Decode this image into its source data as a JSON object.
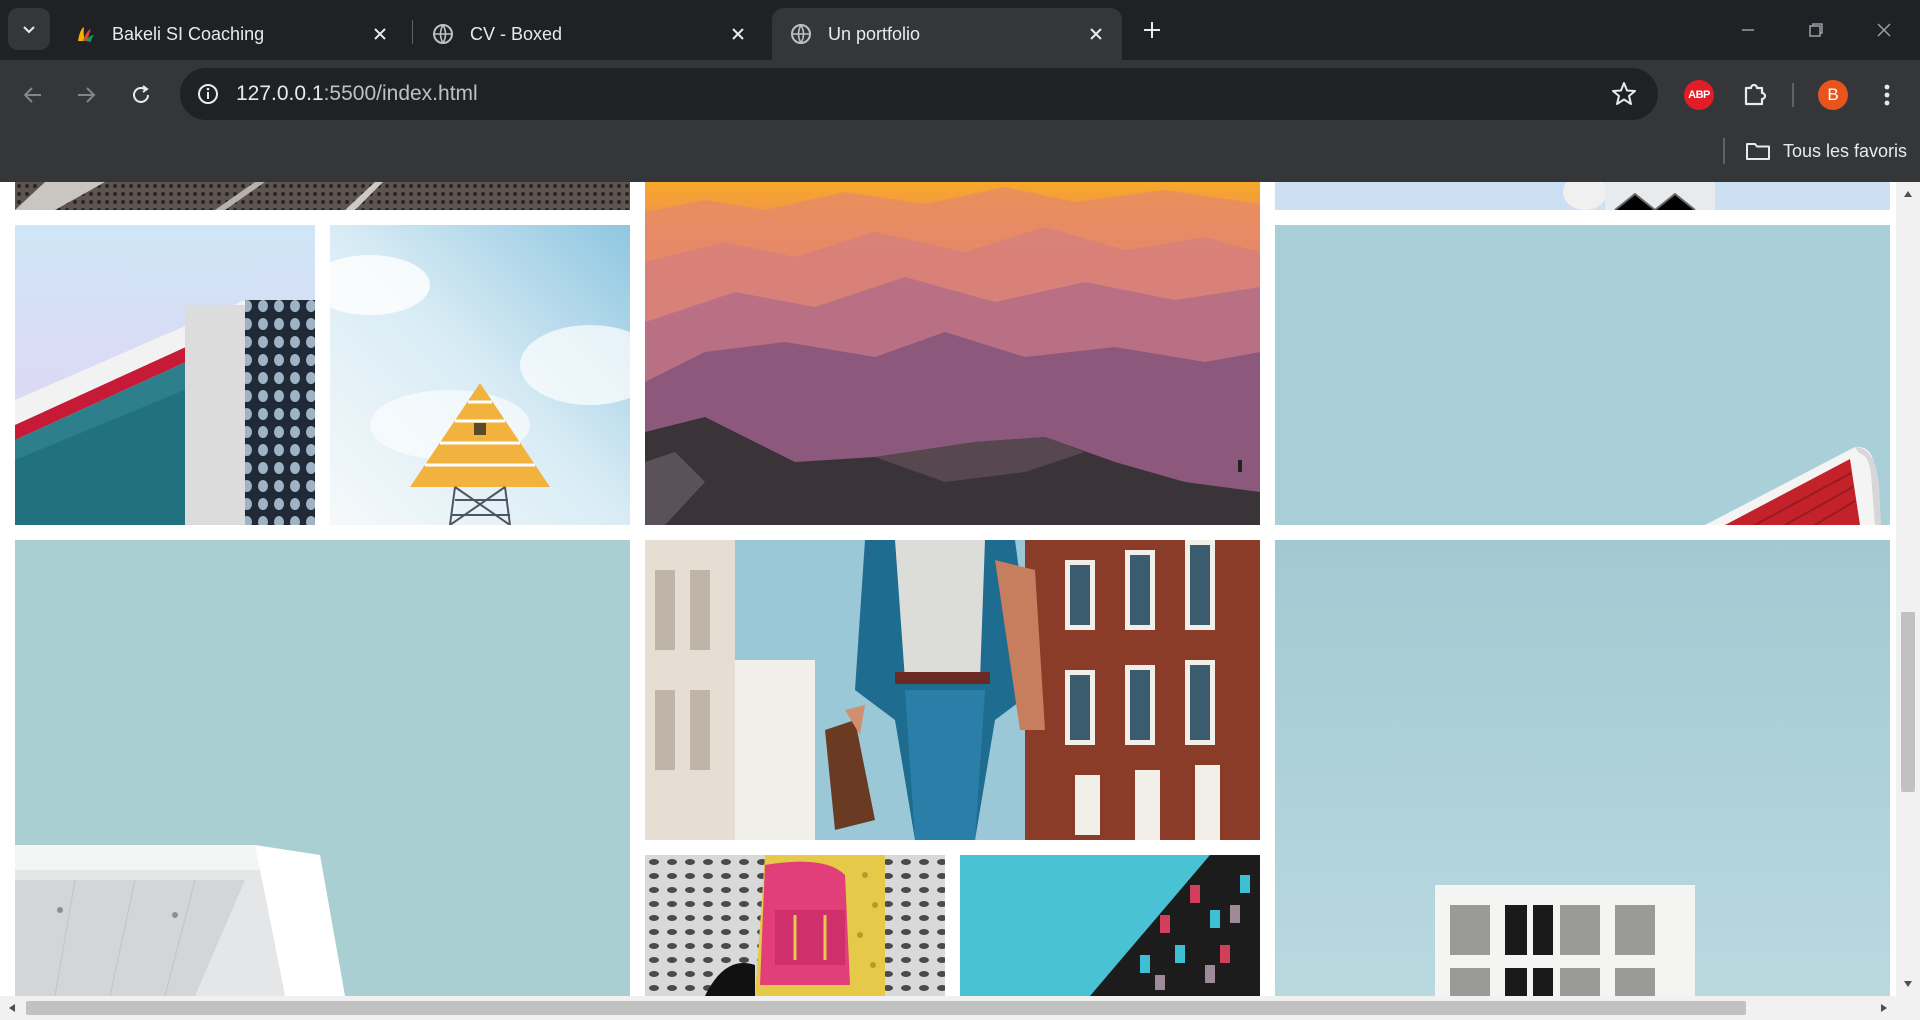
{
  "tabs": [
    {
      "title": "Bakeli SI Coaching",
      "favicon": "bakeli-logo-icon",
      "active": false
    },
    {
      "title": "CV - Boxed",
      "favicon": "globe-icon",
      "active": false
    },
    {
      "title": "Un portfolio",
      "favicon": "globe-icon",
      "active": true
    }
  ],
  "omnibox": {
    "host": "127.0.0.1",
    "path": ":5500/index.html"
  },
  "extensions": {
    "abp_label": "ABP"
  },
  "profile": {
    "initial": "B",
    "color": "#e8541b"
  },
  "bookmarks": {
    "folder_label": "Tous les favoris"
  },
  "gallery": {
    "tiles": [
      {
        "name": "perforated-facade-photo"
      },
      {
        "name": "red-roof-building-photo"
      },
      {
        "name": "pyramid-tower-photo"
      },
      {
        "name": "sunset-mountains-photo"
      },
      {
        "name": "rooftop-sign-photo"
      },
      {
        "name": "red-white-building-corner-photo"
      },
      {
        "name": "white-canopy-photo"
      },
      {
        "name": "man-in-blue-suit-photo"
      },
      {
        "name": "pink-backpack-photo"
      },
      {
        "name": "colorful-facade-photo"
      },
      {
        "name": "white-building-windows-photo"
      }
    ]
  },
  "colors": {
    "chrome_dark": "#202124",
    "chrome_light": "#35363a",
    "abp_red": "#e21d25"
  }
}
